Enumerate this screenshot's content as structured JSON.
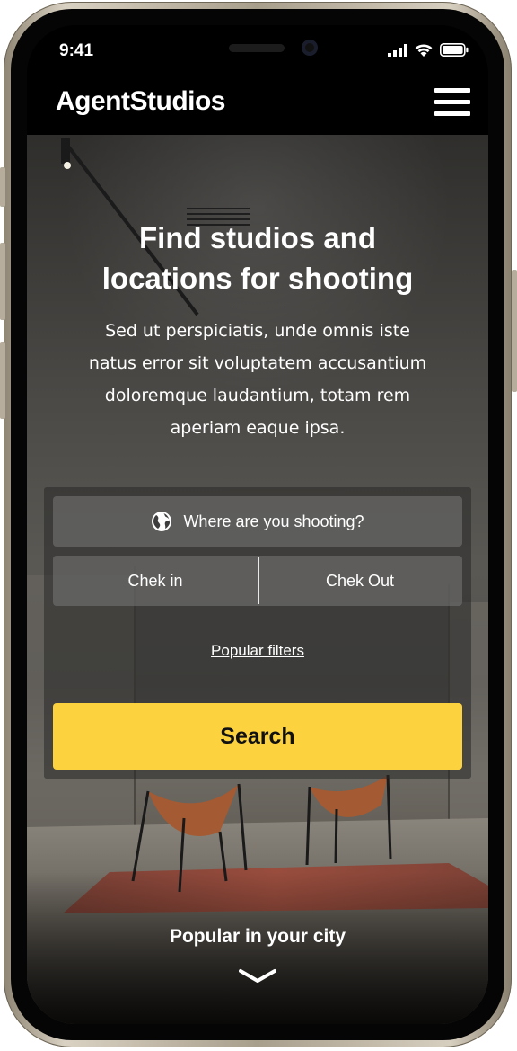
{
  "status_bar": {
    "time": "9:41",
    "icons": [
      "signal-icon",
      "wifi-icon",
      "battery-icon"
    ]
  },
  "header": {
    "logo": "AgentStudios",
    "menu_icon": "hamburger-menu-icon"
  },
  "hero": {
    "title_line1": "Find studios and",
    "title_line2": "locations for shooting",
    "description": "Sed ut perspiciatis, unde omnis iste natus error sit voluptatem accusantium doloremque laudantium, totam rem aperiam eaque ipsa."
  },
  "search": {
    "location_icon": "globe-icon",
    "location_placeholder": "Where are you shooting?",
    "check_in": "Chek in",
    "check_out": "Chek Out",
    "popular_filters": "Popular filters",
    "search_button": "Search"
  },
  "popular": {
    "title": "Popular in your city",
    "chevron_icon": "chevron-down-icon"
  },
  "colors": {
    "accent": "#fcd23e",
    "header_bg": "#000000",
    "text": "#ffffff"
  }
}
